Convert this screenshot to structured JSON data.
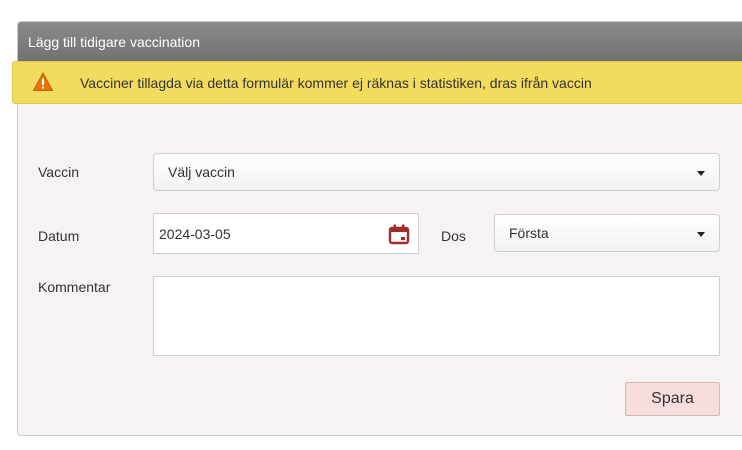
{
  "panel": {
    "title": "Lägg till tidigare vaccination"
  },
  "warning": {
    "icon": "warning-triangle-icon",
    "text": "Vacciner tillagda via detta formulär kommer ej räknas i statistiken, dras ifrån vaccin",
    "color": "#f2dc5d"
  },
  "form": {
    "vaccin_label": "Vaccin",
    "vaccin_value": "Välj vaccin",
    "datum_label": "Datum",
    "datum_value": "2024-03-05",
    "dos_label": "Dos",
    "dos_value": "Första",
    "kommentar_label": "Kommentar",
    "kommentar_value": "",
    "calendar_icon": "calendar-icon",
    "calendar_color": "#a32a2a"
  },
  "actions": {
    "save_label": "Spara"
  }
}
